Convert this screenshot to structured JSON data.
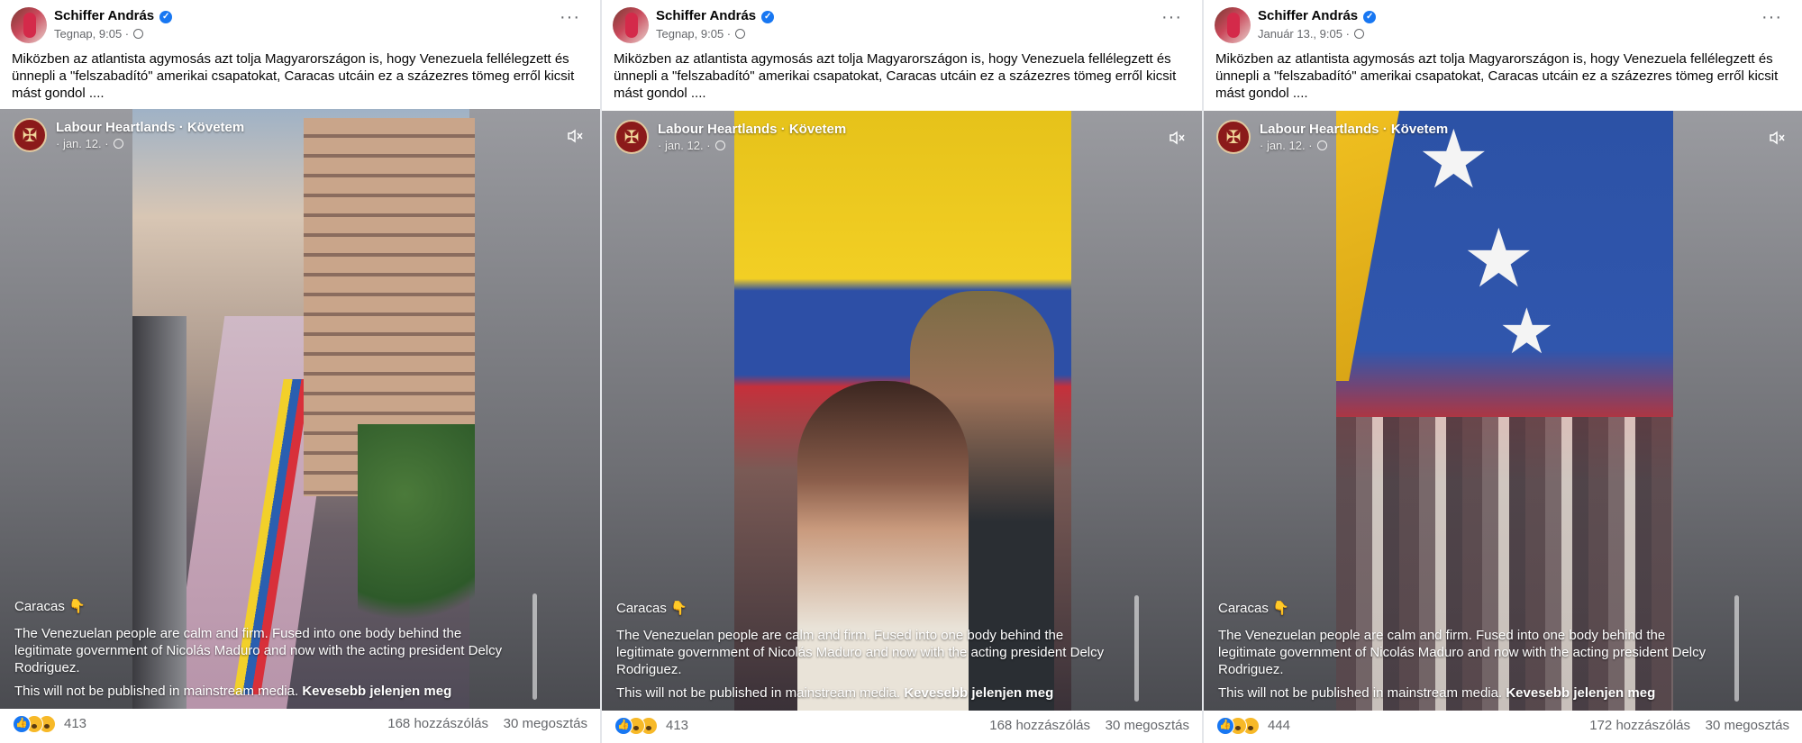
{
  "posts": [
    {
      "author": "Schiffer András",
      "time": "Tegnap, 9:05 ·",
      "text": "Miközben az atlantista agymosás azt tolja Magyarországon is, hogy Venezuela fellélegzett és ünnepli a \"felszabadító\" amerikai csapatokat, Caracas utcáin ez a százezres tömeg erről kicsit mást gondol ....",
      "video": {
        "page_name": "Labour Heartlands · Követem",
        "date": "· jan. 12. ·",
        "caption_title": "Caracas 👇",
        "caption_body": "The Venezuelan people are calm and firm. Fused into one body behind the legitimate government of Nicolás Maduro and now with the acting president Delcy Rodriguez.",
        "caption_foot": "This will not be published in mainstream media.",
        "see_less": "Kevesebb jelenjen meg"
      },
      "reactions_count": "413",
      "comments": "168 hozzászólás",
      "shares": "30 megosztás"
    },
    {
      "author": "Schiffer András",
      "time": "Tegnap, 9:05 ·",
      "text": "Miközben az atlantista agymosás azt tolja Magyarországon is, hogy Venezuela fellélegzett és ünnepli a \"felszabadító\" amerikai csapatokat, Caracas utcáin ez a százezres tömeg erről kicsit mást gondol ....",
      "video": {
        "page_name": "Labour Heartlands · Követem",
        "date": "· jan. 12. ·",
        "caption_title": "Caracas 👇",
        "caption_body": "The Venezuelan people are calm and firm. Fused into one body behind the legitimate government of Nicolás Maduro and now with the acting president Delcy Rodriguez.",
        "caption_foot": "This will not be published in mainstream media.",
        "see_less": "Kevesebb jelenjen meg"
      },
      "reactions_count": "413",
      "comments": "168 hozzászólás",
      "shares": "30 megosztás"
    },
    {
      "author": "Schiffer András",
      "time": "Január 13., 9:05 ·",
      "text": "Miközben az atlantista agymosás azt tolja Magyarországon is, hogy Venezuela fellélegzett és ünnepli a \"felszabadító\" amerikai csapatokat, Caracas utcáin ez a százezres tömeg erről kicsit mást gondol ....",
      "video": {
        "page_name": "Labour Heartlands · Követem",
        "date": "· jan. 12. ·",
        "caption_title": "Caracas 👇",
        "caption_body": "The Venezuelan people are calm and firm. Fused into one body behind the legitimate government of Nicolás Maduro and now with the acting president Delcy Rodriguez.",
        "caption_foot": "This will not be published in mainstream media.",
        "see_less": "Kevesebb jelenjen meg"
      },
      "reactions_count": "444",
      "comments": "172 hozzászólás",
      "shares": "30 megosztás"
    }
  ],
  "icons": {
    "verified": "verified-badge-icon",
    "globe": "globe-icon",
    "more": "more-options-icon",
    "mute": "muted-speaker-icon",
    "reactions": [
      "like-icon",
      "haha-icon",
      "wow-icon"
    ]
  },
  "colors": {
    "accent": "#1877f2",
    "secondary_text": "#65676b"
  }
}
